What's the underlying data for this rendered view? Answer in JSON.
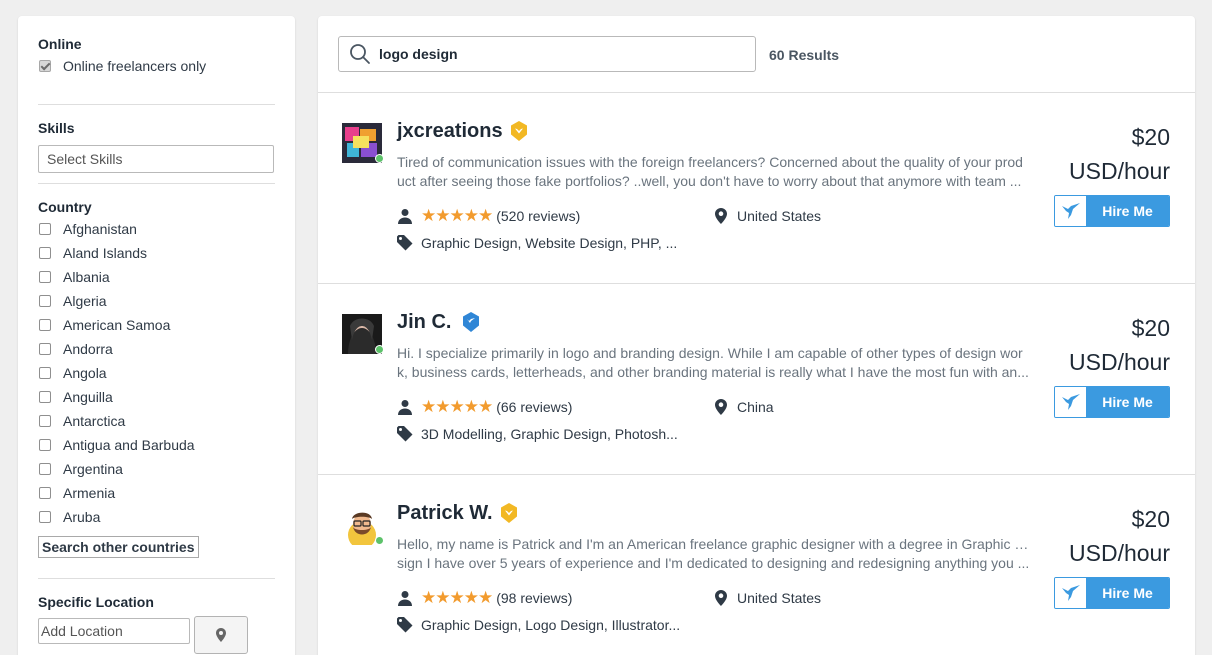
{
  "filters": {
    "online": {
      "title": "Online",
      "checkbox_label": "Online freelancers only",
      "checked": true
    },
    "skills": {
      "title": "Skills",
      "placeholder": "Select Skills"
    },
    "country": {
      "title": "Country",
      "options": [
        "Afghanistan",
        "Aland Islands",
        "Albania",
        "Algeria",
        "American Samoa",
        "Andorra",
        "Angola",
        "Anguilla",
        "Antarctica",
        "Antigua and Barbuda",
        "Argentina",
        "Armenia",
        "Aruba"
      ],
      "search_other_label": "Search other countries"
    },
    "location": {
      "title": "Specific Location",
      "placeholder": "Add Location"
    }
  },
  "search": {
    "query": "logo design",
    "results_label": "60 Results"
  },
  "freelancers": [
    {
      "name": "jxcreations",
      "badge_color": "#f2b824",
      "desc_line1": "Tired of communication issues with the foreign freelancers? Concerned about the quality of your prod",
      "desc_line2": "uct after seeing those fake portfolios? ..well, you don't have to worry about that anymore with team ...",
      "rating_stars": 5,
      "reviews": "(520 reviews)",
      "location": "United States",
      "skills": "Graphic Design, Website Design, PHP, ...",
      "price": "$20",
      "price_unit": "USD/hour",
      "hire_label": "Hire Me",
      "online": true
    },
    {
      "name": "Jin C.",
      "badge_color": "#2f86d6",
      "desc_line1": "Hi. I specialize primarily in logo and branding design. While I am capable of other types of design wor",
      "desc_line2": "k, business cards, letterheads, and other branding material is really what I have the most fun with an...",
      "rating_stars": 5,
      "reviews": "(66 reviews)",
      "location": "China",
      "skills": "3D Modelling, Graphic Design, Photosh...",
      "price": "$20",
      "price_unit": "USD/hour",
      "hire_label": "Hire Me",
      "online": true
    },
    {
      "name": "Patrick W.",
      "badge_color": "#f2b824",
      "desc_line1": "Hello, my name is Patrick and I'm an American freelance graphic designer with a degree in Graphic De",
      "desc_line2": "sign I have over 5 years of experience and I'm dedicated to designing and redesigning anything you ...",
      "rating_stars": 5,
      "reviews": "(98 reviews)",
      "location": "United States",
      "skills": "Graphic Design, Logo Design, Illustrator...",
      "price": "$20",
      "price_unit": "USD/hour",
      "hire_label": "Hire Me",
      "online": true
    }
  ],
  "icons": {
    "search": "search-icon",
    "user": "user-icon",
    "pin": "map-pin-icon",
    "tag": "tag-icon",
    "bird": "hummingbird-icon",
    "verified": "verified-badge-icon"
  },
  "colors": {
    "accent": "#3b9ae0",
    "star": "#f29b2e",
    "online": "#5dc26a"
  }
}
